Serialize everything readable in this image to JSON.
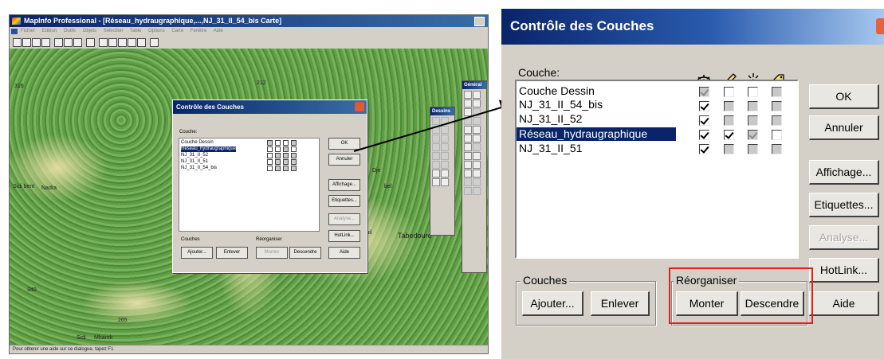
{
  "main_window": {
    "title": "MapInfo Professional - [Réseau_hydraugraphique,...,NJ_31_II_54_bis Carte]",
    "menu": [
      "Fichier",
      "Edition",
      "Outils",
      "Objets",
      "Sélection",
      "Table",
      "Options",
      "Carte",
      "Fenêtre",
      "Aide"
    ],
    "status": "Pour obtenir une aide sur ce dialogue, tapez F1",
    "map_labels": [
      "316",
      "212",
      "Sidi bent",
      "Nadra",
      "Dje",
      "bel",
      "Touil",
      "Tabedoure",
      "265",
      "Sidi",
      "Mbarek",
      "340"
    ]
  },
  "small_dialog": {
    "title": "Contrôle des Couches",
    "couche_label": "Couche:",
    "layers": [
      "Couche Dessin",
      "Réseau_hydraugraphique",
      "NJ_31_II_52",
      "NJ_31_II_51",
      "NJ_31_II_54_bis"
    ],
    "buttons": {
      "ok": "OK",
      "cancel": "Annuler",
      "display": "Affichage...",
      "labels": "Etiquettes...",
      "analyse": "Analyse...",
      "hotlink": "HotLink...",
      "help": "Aide",
      "add": "Ajouter...",
      "remove": "Enlever",
      "up": "Monter",
      "down": "Descendre"
    },
    "group_couches": "Couches",
    "group_reorg": "Réorganiser"
  },
  "toolbars": {
    "general": "Général",
    "dessins": "Dessins"
  },
  "dialog": {
    "title": "Contrôle des Couches",
    "couche_label": "Couche:",
    "column_icons": [
      "visible-eye-icon",
      "editable-pencil-icon",
      "selectable-arrow-icon",
      "autolabel-tag-icon"
    ],
    "layers": [
      {
        "name": "Couche Dessin",
        "selected": false,
        "checks": [
          "checked-disabled",
          "unchecked",
          "unchecked",
          "unchecked-disabled"
        ]
      },
      {
        "name": "NJ_31_II_54_bis",
        "selected": false,
        "checks": [
          "checked",
          "unchecked-disabled",
          "unchecked-disabled",
          "unchecked-disabled"
        ]
      },
      {
        "name": "NJ_31_II_52",
        "selected": false,
        "checks": [
          "checked",
          "unchecked-disabled",
          "unchecked-disabled",
          "unchecked-disabled"
        ]
      },
      {
        "name": "Réseau_hydraugraphique",
        "selected": true,
        "checks": [
          "checked",
          "checked",
          "checked-disabled",
          "unchecked"
        ]
      },
      {
        "name": "NJ_31_II_51",
        "selected": false,
        "checks": [
          "checked",
          "unchecked-disabled",
          "unchecked-disabled",
          "unchecked-disabled"
        ]
      }
    ],
    "buttons": {
      "ok": "OK",
      "cancel": "Annuler",
      "display": "Affichage...",
      "labels": "Etiquettes...",
      "analyse": "Analyse...",
      "hotlink": "HotLink...",
      "help": "Aide",
      "add": "Ajouter...",
      "remove": "Enlever",
      "up": "Monter",
      "down": "Descendre"
    },
    "group_couches": "Couches",
    "group_reorg": "Réorganiser"
  },
  "colors": {
    "title_bar": "#0a246a",
    "selection": "#0a246a",
    "dialog_bg": "#d4d0c8",
    "highlight_red": "#e02020"
  }
}
